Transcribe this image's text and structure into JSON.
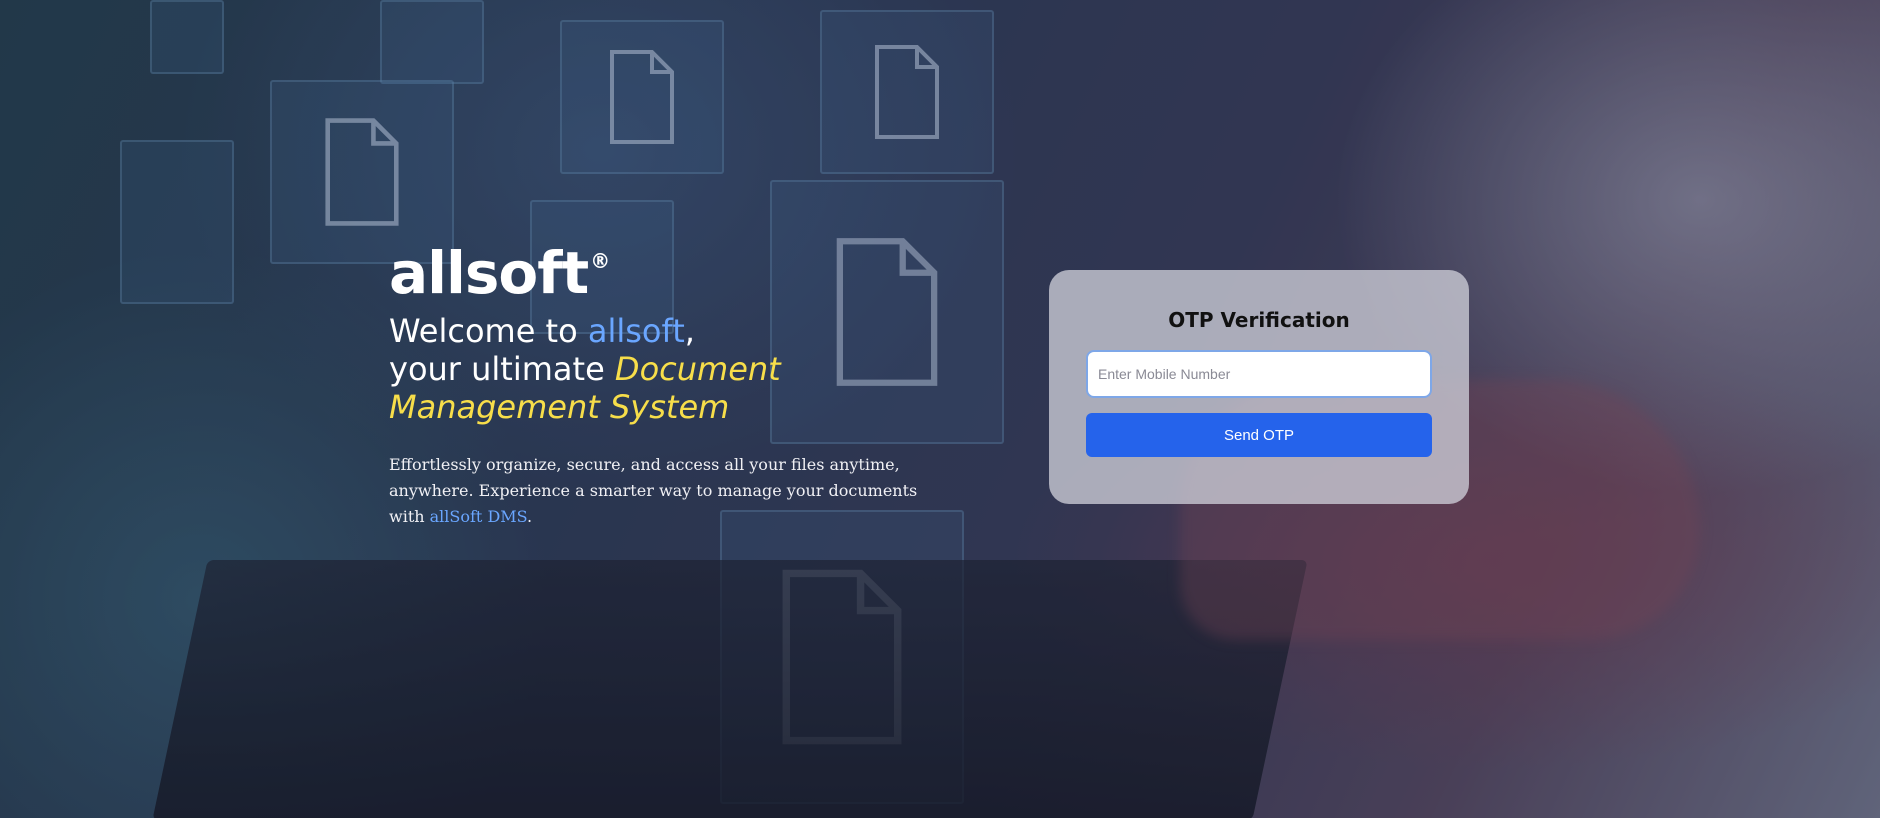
{
  "hero": {
    "brand_name": "allsoft",
    "brand_mark": "®",
    "headline_prefix": "Welcome to ",
    "headline_brand": "allsoft",
    "headline_comma": ",",
    "headline_line2": "your ultimate ",
    "headline_highlight_1": "Document",
    "headline_highlight_2": "Management System",
    "tagline_text": "Effortlessly organize, secure, and access all your files anytime, anywhere. Experience a smarter way to manage your documents with ",
    "tagline_link": "allSoft DMS",
    "tagline_end": "."
  },
  "otp_card": {
    "title": "OTP Verification",
    "mobile_placeholder": "Enter Mobile Number",
    "mobile_value": "",
    "send_button": "Send OTP"
  },
  "colors": {
    "accent_blue": "#2563eb",
    "brand_blue": "#6aa6ff",
    "highlight_yellow": "#f7de4a"
  },
  "icons": [
    "document-icon"
  ]
}
